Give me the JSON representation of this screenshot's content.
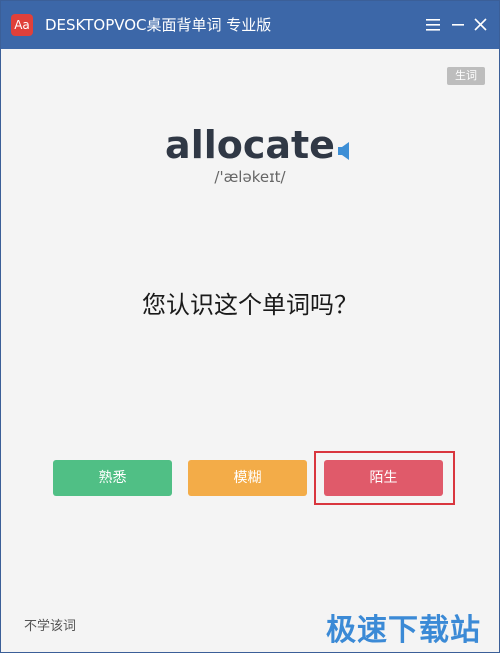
{
  "window": {
    "title": "DESKTOPVOC桌面背单词 专业版",
    "icon_label": "Aa",
    "icons": [
      "menu-icon",
      "minimize-icon",
      "close-icon"
    ]
  },
  "card": {
    "badge": "生词",
    "word": "allocate",
    "phonetic": "/'æləkeɪt/",
    "question": "您认识这个单词吗？"
  },
  "choices": {
    "known": "熟悉",
    "vague": "模糊",
    "unknown": "陌生"
  },
  "footer": {
    "skip_label": "不学该词",
    "watermark": "极速下载站"
  },
  "colors": {
    "titlebar": "#3c67a8",
    "known": "#50bf85",
    "vague": "#f3ac48",
    "unknown": "#e05a6a",
    "highlight": "#d9363e",
    "watermark": "#3b8ad6"
  }
}
